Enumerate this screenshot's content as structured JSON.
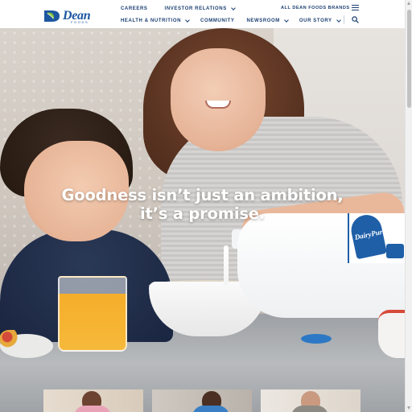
{
  "brand": {
    "logo_icon": "dean-d-leaf-icon",
    "name": "Dean",
    "sub": "FOODS",
    "color": "#1c56a0"
  },
  "nav_top": {
    "careers": "CAREERS",
    "investor_relations": "INVESTOR RELATIONS",
    "all_brands": "ALL DEAN FOODS BRANDS"
  },
  "nav_main": {
    "health": "HEALTH & NUTRITION",
    "community": "COMMUNITY",
    "newsroom": "NEWSROOM",
    "our_story": "OUR STORY"
  },
  "icons": {
    "menu": "hamburger-menu-icon",
    "search": "search-icon",
    "chevron": "chevron-down-icon"
  },
  "hero": {
    "headline_line1": "Goodness isn’t just an ambition,",
    "headline_line2": "it’s a promise.",
    "product_label": "DairyPure"
  },
  "colors": {
    "nav_text": "#1b3f72",
    "accent_blue": "#1f5fa8"
  }
}
